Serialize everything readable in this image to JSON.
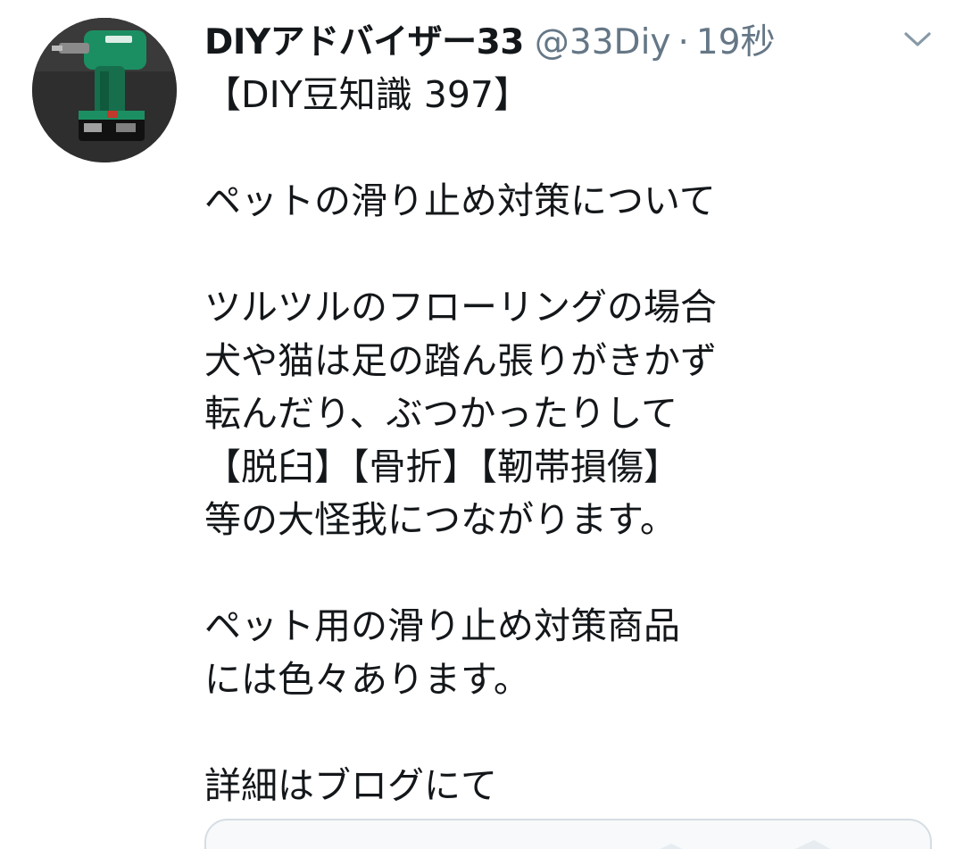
{
  "tweet": {
    "display_name": "DIYアドバイザー33",
    "handle": "@33Diy",
    "separator": "·",
    "timestamp": "19秒",
    "text": "【DIY豆知識 397】\n\nペットの滑り止め対策について\n\nツルツルのフローリングの場合\n犬や猫は足の踏ん張りがきかず\n転んだり、ぶつかったりして\n【脱臼】【骨折】【靭帯損傷】\n等の大怪我につながります。\n\nペット用の滑り止め対策商品\nには色々あります。\n\n詳細はブログにて",
    "avatar_icon": "impact-driver-photo",
    "menu_icon": "chevron-down-icon",
    "link_card_icon": "image-placeholder-icon"
  },
  "colors": {
    "primary_text": "#14171a",
    "secondary_text": "#657786",
    "card_border": "#d6dde3",
    "drill_green": "#1f9a6e"
  }
}
